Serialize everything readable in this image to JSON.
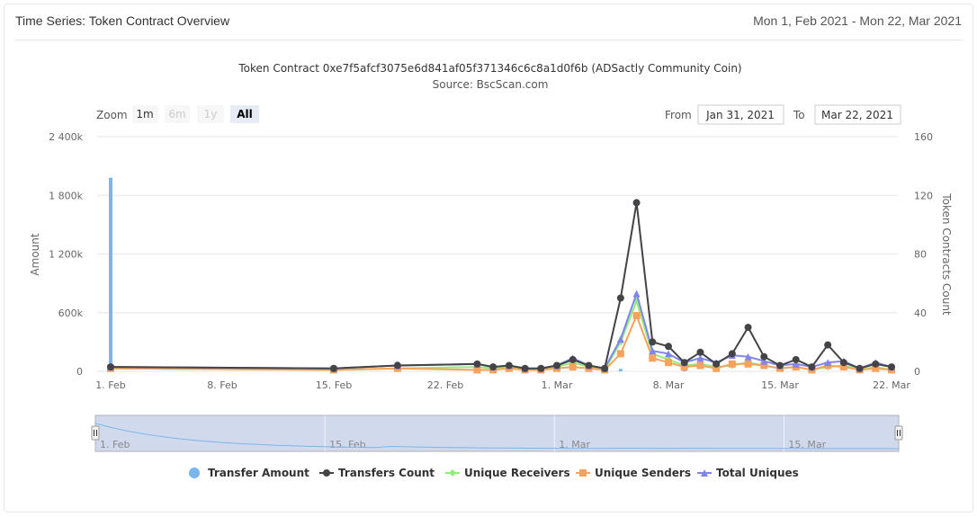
{
  "header": {
    "title": "Time Series: Token Contract Overview",
    "date_range": "Mon 1, Feb 2021 - Mon 22, Mar 2021"
  },
  "range_selector": {
    "zoom_label": "Zoom",
    "buttons": [
      {
        "label": "1m",
        "state": "normal"
      },
      {
        "label": "6m",
        "state": "disabled"
      },
      {
        "label": "1y",
        "state": "disabled"
      },
      {
        "label": "All",
        "state": "selected"
      }
    ],
    "from_label": "From",
    "from_value": "Jan 31, 2021",
    "to_label": "To",
    "to_value": "Mar 22, 2021"
  },
  "colors": {
    "transfer_amount": "#7cb5ec",
    "transfers_count": "#434348",
    "unique_receivers": "#90ed7d",
    "unique_senders": "#f7a35c",
    "total_uniques": "#8085e9",
    "navigator_fill": "#ccd6eb"
  },
  "chart_data": {
    "type": "line",
    "title": "Token Contract 0xe7f5afcf3075e6d841af05f371346c6c8a1d0f6b (ADSactly Community Coin)",
    "subtitle": "Source: BscScan.com",
    "x_start": "2021-02-01",
    "x_end": "2021-03-22",
    "x_ticks": [
      "1. Feb",
      "8. Feb",
      "15. Feb",
      "22. Feb",
      "1. Mar",
      "8. Mar",
      "15. Mar",
      "22. Mar"
    ],
    "navigator_ticks": [
      "1. Feb",
      "15. Feb",
      "1. Mar",
      "15. Mar"
    ],
    "y_left": {
      "label": "Amount",
      "min": 0,
      "max": 2400000,
      "ticks": [
        "0",
        "600k",
        "1 200k",
        "1 800k",
        "2 400k"
      ]
    },
    "y_right": {
      "label": "Token Contracts Count",
      "min": 0,
      "max": 160,
      "ticks": [
        "0",
        "40",
        "80",
        "120",
        "160"
      ]
    },
    "legend": {
      "position": "bottom"
    },
    "series": [
      {
        "name": "Transfer Amount",
        "type": "column",
        "axis": "left",
        "points": [
          [
            "2021-02-01",
            1980000
          ],
          [
            "2021-02-19",
            100000
          ],
          [
            "2021-03-05",
            25000
          ],
          [
            "2021-03-09",
            15000
          ]
        ]
      },
      {
        "name": "Transfers Count",
        "type": "line",
        "axis": "right",
        "points": [
          [
            "2021-02-01",
            3
          ],
          [
            "2021-02-15",
            2
          ],
          [
            "2021-02-19",
            4
          ],
          [
            "2021-02-24",
            5
          ],
          [
            "2021-02-25",
            3
          ],
          [
            "2021-02-26",
            4
          ],
          [
            "2021-02-27",
            2
          ],
          [
            "2021-02-28",
            2
          ],
          [
            "2021-03-01",
            4
          ],
          [
            "2021-03-02",
            8
          ],
          [
            "2021-03-03",
            4
          ],
          [
            "2021-03-04",
            2
          ],
          [
            "2021-03-05",
            50
          ],
          [
            "2021-03-06",
            115
          ],
          [
            "2021-03-07",
            20
          ],
          [
            "2021-03-08",
            17
          ],
          [
            "2021-03-09",
            6
          ],
          [
            "2021-03-10",
            13
          ],
          [
            "2021-03-11",
            5
          ],
          [
            "2021-03-12",
            12
          ],
          [
            "2021-03-13",
            30
          ],
          [
            "2021-03-14",
            10
          ],
          [
            "2021-03-15",
            4
          ],
          [
            "2021-03-16",
            8
          ],
          [
            "2021-03-17",
            3
          ],
          [
            "2021-03-18",
            18
          ],
          [
            "2021-03-19",
            6
          ],
          [
            "2021-03-20",
            2
          ],
          [
            "2021-03-21",
            5
          ],
          [
            "2021-03-22",
            3
          ]
        ]
      },
      {
        "name": "Unique Receivers",
        "type": "line",
        "axis": "right",
        "points": [
          [
            "2021-02-01",
            2
          ],
          [
            "2021-02-15",
            1
          ],
          [
            "2021-02-19",
            2
          ],
          [
            "2021-02-24",
            3
          ],
          [
            "2021-02-25",
            2
          ],
          [
            "2021-02-26",
            3
          ],
          [
            "2021-02-27",
            1
          ],
          [
            "2021-02-28",
            1
          ],
          [
            "2021-03-01",
            3
          ],
          [
            "2021-03-02",
            6
          ],
          [
            "2021-03-03",
            3
          ],
          [
            "2021-03-04",
            1
          ],
          [
            "2021-03-05",
            20
          ],
          [
            "2021-03-06",
            48
          ],
          [
            "2021-03-07",
            12
          ],
          [
            "2021-03-08",
            8
          ],
          [
            "2021-03-09",
            4
          ],
          [
            "2021-03-10",
            5
          ],
          [
            "2021-03-11",
            3
          ],
          [
            "2021-03-12",
            4
          ],
          [
            "2021-03-13",
            6
          ],
          [
            "2021-03-14",
            4
          ],
          [
            "2021-03-15",
            2
          ],
          [
            "2021-03-16",
            3
          ],
          [
            "2021-03-17",
            1
          ],
          [
            "2021-03-18",
            3
          ],
          [
            "2021-03-19",
            4
          ],
          [
            "2021-03-20",
            1
          ],
          [
            "2021-03-21",
            3
          ],
          [
            "2021-03-22",
            1
          ]
        ]
      },
      {
        "name": "Unique Senders",
        "type": "line",
        "axis": "right",
        "points": [
          [
            "2021-02-01",
            2
          ],
          [
            "2021-02-15",
            1
          ],
          [
            "2021-02-19",
            2
          ],
          [
            "2021-02-24",
            1
          ],
          [
            "2021-02-25",
            1
          ],
          [
            "2021-02-26",
            2
          ],
          [
            "2021-02-27",
            1
          ],
          [
            "2021-02-28",
            1
          ],
          [
            "2021-03-01",
            2
          ],
          [
            "2021-03-02",
            3
          ],
          [
            "2021-03-03",
            2
          ],
          [
            "2021-03-04",
            1
          ],
          [
            "2021-03-05",
            12
          ],
          [
            "2021-03-06",
            38
          ],
          [
            "2021-03-07",
            9
          ],
          [
            "2021-03-08",
            6
          ],
          [
            "2021-03-09",
            3
          ],
          [
            "2021-03-10",
            4
          ],
          [
            "2021-03-11",
            2
          ],
          [
            "2021-03-12",
            5
          ],
          [
            "2021-03-13",
            5
          ],
          [
            "2021-03-14",
            4
          ],
          [
            "2021-03-15",
            2
          ],
          [
            "2021-03-16",
            3
          ],
          [
            "2021-03-17",
            1
          ],
          [
            "2021-03-18",
            4
          ],
          [
            "2021-03-19",
            3
          ],
          [
            "2021-03-20",
            1
          ],
          [
            "2021-03-21",
            2
          ],
          [
            "2021-03-22",
            1
          ]
        ]
      },
      {
        "name": "Total Uniques",
        "type": "line",
        "axis": "right",
        "points": [
          [
            "2021-02-01",
            3
          ],
          [
            "2021-02-15",
            2
          ],
          [
            "2021-02-19",
            4
          ],
          [
            "2021-02-24",
            5
          ],
          [
            "2021-02-25",
            3
          ],
          [
            "2021-02-26",
            4
          ],
          [
            "2021-02-27",
            2
          ],
          [
            "2021-02-28",
            2
          ],
          [
            "2021-03-01",
            4
          ],
          [
            "2021-03-02",
            9
          ],
          [
            "2021-03-03",
            4
          ],
          [
            "2021-03-04",
            2
          ],
          [
            "2021-03-05",
            22
          ],
          [
            "2021-03-06",
            53
          ],
          [
            "2021-03-07",
            14
          ],
          [
            "2021-03-08",
            12
          ],
          [
            "2021-03-09",
            6
          ],
          [
            "2021-03-10",
            9
          ],
          [
            "2021-03-11",
            6
          ],
          [
            "2021-03-12",
            11
          ],
          [
            "2021-03-13",
            10
          ],
          [
            "2021-03-14",
            7
          ],
          [
            "2021-03-15",
            4
          ],
          [
            "2021-03-16",
            5
          ],
          [
            "2021-03-17",
            3
          ],
          [
            "2021-03-18",
            6
          ],
          [
            "2021-03-19",
            7
          ],
          [
            "2021-03-20",
            2
          ],
          [
            "2021-03-21",
            6
          ],
          [
            "2021-03-22",
            3
          ]
        ]
      }
    ],
    "navigator_series": "Transfer Amount"
  }
}
